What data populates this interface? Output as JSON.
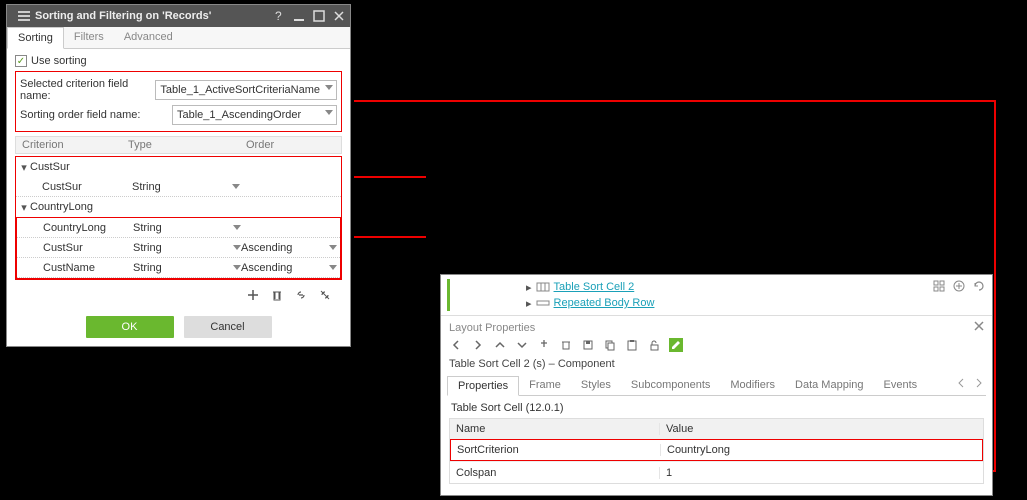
{
  "dialog": {
    "title": "Sorting and Filtering on 'Records'",
    "tabs": [
      "Sorting",
      "Filters",
      "Advanced"
    ],
    "useSortingLabel": "Use sorting",
    "useSortingChecked": true,
    "fields": {
      "criterionLabel": "Selected criterion field name:",
      "criterionValue": "Table_1_ActiveSortCriteriaName",
      "orderLabel": "Sorting order field name:",
      "orderValue": "Table_1_AscendingOrder"
    },
    "columns": {
      "criterion": "Criterion",
      "type": "Type",
      "order": "Order"
    },
    "groups": [
      {
        "name": "CustSur",
        "rows": [
          {
            "criterion": "CustSur",
            "type": "String",
            "order": ""
          }
        ]
      },
      {
        "name": "CountryLong",
        "rows": [
          {
            "criterion": "CountryLong",
            "type": "String",
            "order": ""
          },
          {
            "criterion": "CustSur",
            "type": "String",
            "order": "Ascending"
          },
          {
            "criterion": "CustName",
            "type": "String",
            "order": "Ascending"
          }
        ]
      }
    ],
    "buttons": {
      "ok": "OK",
      "cancel": "Cancel"
    }
  },
  "layout": {
    "breadcrumb": {
      "item1": "Table Sort Cell 2",
      "item2": "Repeated Body Row"
    },
    "panelTitle": "Layout Properties",
    "subtitle": "Table Sort Cell 2 (s) – Component",
    "tabs": [
      "Properties",
      "Frame",
      "Styles",
      "Subcomponents",
      "Modifiers",
      "Data Mapping",
      "Events"
    ],
    "propTitle": "Table Sort Cell (12.0.1)",
    "propHead": {
      "name": "Name",
      "value": "Value"
    },
    "props": [
      {
        "name": "SortCriterion",
        "value": "CountryLong",
        "highlight": true
      },
      {
        "name": "Colspan",
        "value": "1",
        "highlight": false
      }
    ]
  }
}
